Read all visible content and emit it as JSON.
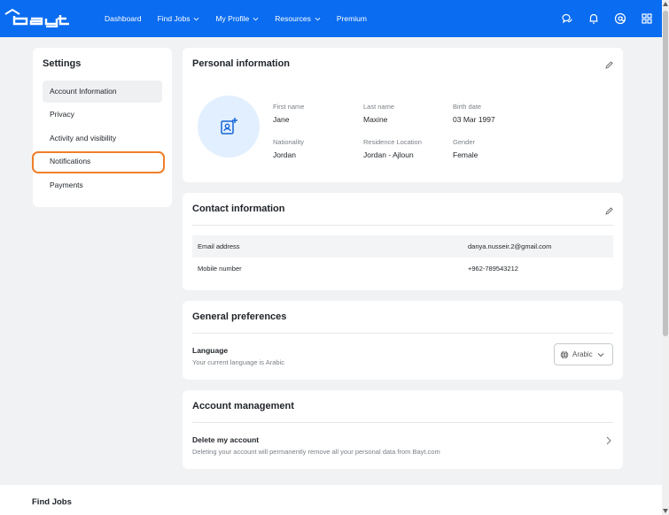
{
  "brand": {
    "logo_text": "bayt",
    "accent_color": "#0a6cf0",
    "highlight_color": "#ef7f2a"
  },
  "nav": {
    "items": [
      {
        "label": "Dashboard",
        "has_dropdown": false
      },
      {
        "label": "Find Jobs",
        "has_dropdown": true
      },
      {
        "label": "My Profile",
        "has_dropdown": true
      },
      {
        "label": "Resources",
        "has_dropdown": true
      },
      {
        "label": "Premium",
        "has_dropdown": false
      }
    ],
    "icons": [
      "chat-icon",
      "bell-icon",
      "at-icon",
      "apps-grid-icon"
    ]
  },
  "settings": {
    "title": "Settings",
    "items": [
      {
        "label": "Account Information",
        "active": true
      },
      {
        "label": "Privacy"
      },
      {
        "label": "Activity and visibility"
      },
      {
        "label": "Notifications",
        "highlighted": true
      },
      {
        "label": "Payments"
      }
    ]
  },
  "personal": {
    "title": "Personal information",
    "first_name_label": "First name",
    "first_name": "Jane",
    "last_name_label": "Last name",
    "last_name": "Maxine",
    "birth_date_label": "Birth date",
    "birth_date": "03 Mar 1997",
    "nationality_label": "Nationality",
    "nationality": "Jordan",
    "residence_label": "Residence Location",
    "residence": "Jordan - Ajloun",
    "gender_label": "Gender",
    "gender": "Female"
  },
  "contact": {
    "title": "Contact information",
    "rows": [
      {
        "label": "Email address",
        "value": "danya.nusseir.2@gmail.com"
      },
      {
        "label": "Mobile number",
        "value": "+962-789543212"
      }
    ]
  },
  "preferences": {
    "title": "General preferences",
    "language_title": "Language",
    "language_text": "Your current language is Arabic",
    "language_value": "Arabic"
  },
  "account": {
    "title": "Account management",
    "delete_title": "Delete my account",
    "delete_text": "Deleting your account will permanently remove all your personal data from Bayt.com"
  },
  "footer": {
    "title": "Find Jobs"
  }
}
